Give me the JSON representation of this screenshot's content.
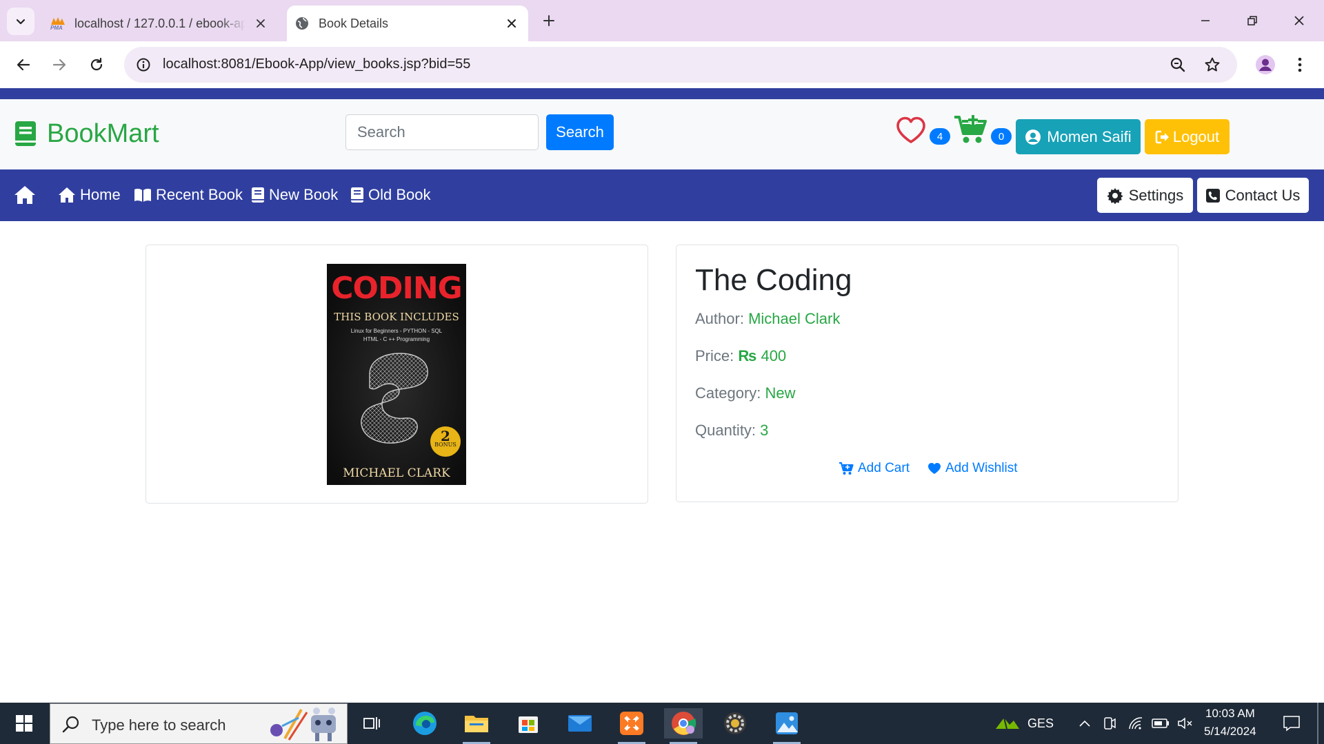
{
  "browser": {
    "tabs": [
      {
        "title": "localhost / 127.0.0.1 / ebook-app",
        "active": false
      },
      {
        "title": "Book Details",
        "active": true
      }
    ],
    "url": "localhost:8081/Ebook-App/view_books.jsp?bid=55"
  },
  "header": {
    "brand": "BookMart",
    "search_placeholder": "Search",
    "search_button": "Search",
    "wishlist_count": "4",
    "cart_count": "0",
    "user_name": "Momen Saifi",
    "logout_label": "Logout"
  },
  "navbar": {
    "links": [
      "Home",
      "Recent Book",
      "New Book",
      "Old Book"
    ],
    "settings_label": "Settings",
    "contact_label": "Contact Us"
  },
  "book": {
    "cover": {
      "title": "CODING",
      "subtitle": "THIS BOOK INCLUDES",
      "topics_line1": "Linux for Beginners - PYTHON - SQL",
      "topics_line2": "HTML - C ++ Programming",
      "badge_number": "2",
      "badge_text": "BONUS",
      "author": "MICHAEL CLARK"
    },
    "title": "The Coding",
    "author_label": "Author:",
    "author": "Michael Clark",
    "price_label": "Price:",
    "currency_symbol": "₨",
    "price": "400",
    "category_label": "Category:",
    "category": "New",
    "quantity_label": "Quantity:",
    "quantity": "3",
    "add_cart_label": "Add Cart",
    "add_wishlist_label": "Add Wishlist"
  },
  "taskbar": {
    "search_placeholder": "Type here to search",
    "tray_label": "GES",
    "time": "10:03 AM",
    "date": "5/14/2024"
  },
  "colors": {
    "brand_green": "#28a745",
    "nav_blue": "#303f9f",
    "primary": "#007bff",
    "info": "#17a2b8",
    "warning": "#ffc107",
    "heart_red": "#dc3545"
  }
}
